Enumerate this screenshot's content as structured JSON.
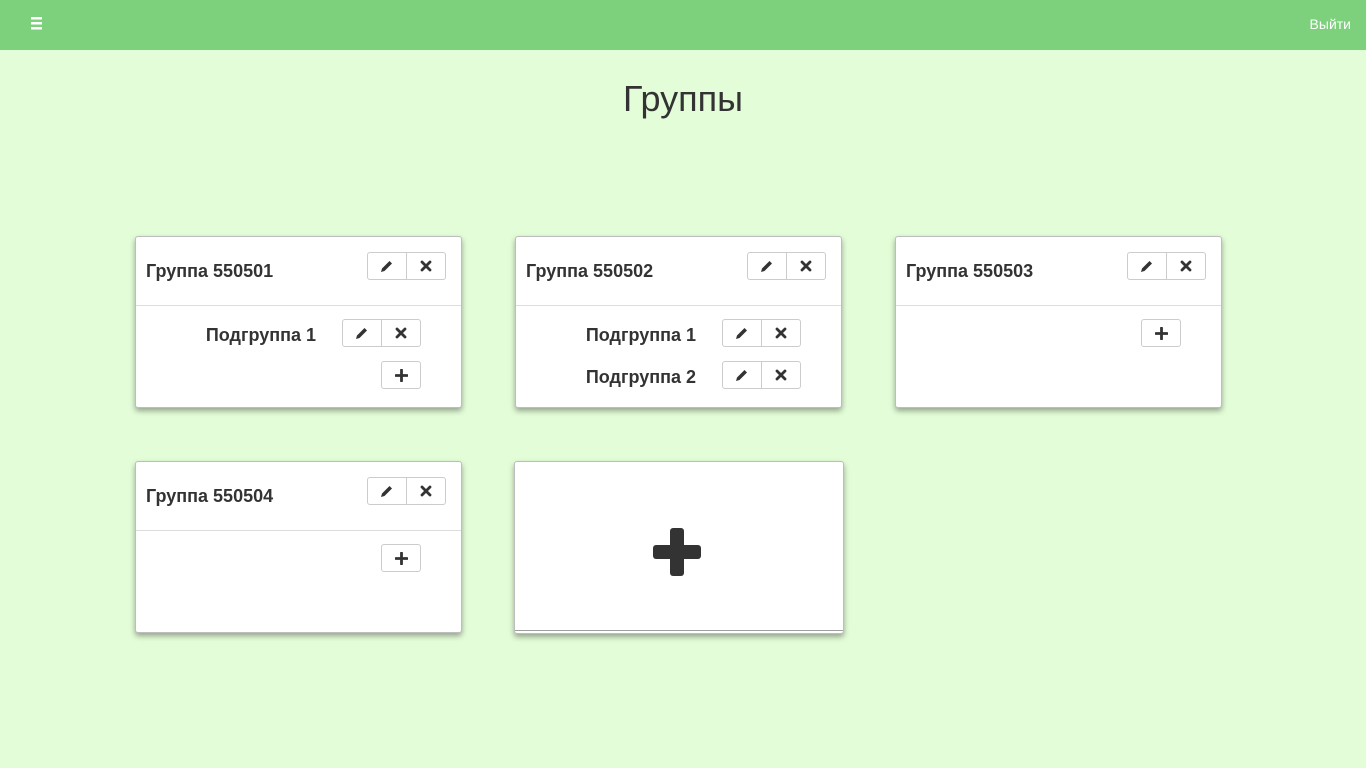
{
  "header": {
    "menu_icon": "hamburger-icon",
    "logout_label": "Выйти",
    "accent_color": "#7dd17d",
    "background_color": "#e3fdd8"
  },
  "page": {
    "title": "Группы"
  },
  "groups": [
    {
      "title": "Группа 550501",
      "subgroups": [
        {
          "label": "Подгруппа 1"
        }
      ]
    },
    {
      "title": "Группа 550502",
      "subgroups": [
        {
          "label": "Подгруппа 1"
        },
        {
          "label": "Подгруппа 2"
        }
      ]
    },
    {
      "title": "Группа 550503",
      "subgroups": []
    },
    {
      "title": "Группа 550504",
      "subgroups": []
    }
  ],
  "icons": {
    "edit": "pencil-icon",
    "delete": "close-icon",
    "add": "plus-icon"
  }
}
